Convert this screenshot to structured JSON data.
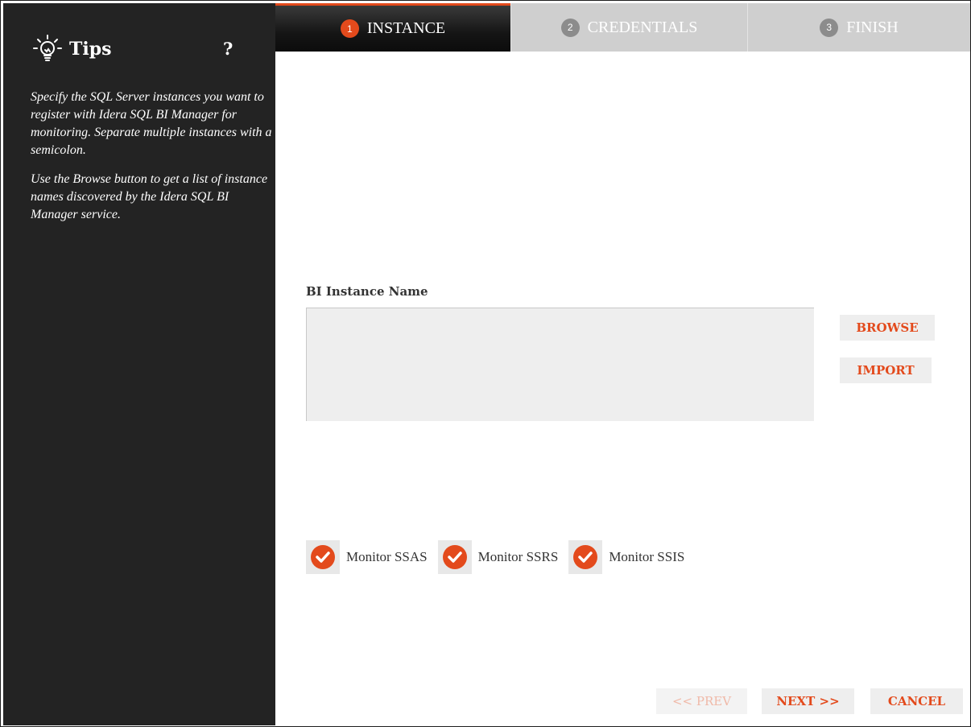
{
  "sidebar": {
    "title": "Tips",
    "help": "?",
    "tips": [
      "Specify the SQL Server instances you want to register with Idera SQL BI Manager for monitoring. Separate multiple instances with a semicolon.",
      "Use the Browse button to get a list of instance names discovered by the Idera SQL BI Manager service."
    ]
  },
  "tabs": [
    {
      "num": "1",
      "label": "INSTANCE"
    },
    {
      "num": "2",
      "label": "CREDENTIALS"
    },
    {
      "num": "3",
      "label": "FINISH"
    }
  ],
  "form": {
    "label": "BI Instance Name",
    "value": "",
    "browse": "BROWSE",
    "import": "IMPORT"
  },
  "checkboxes": [
    {
      "label": "Monitor SSAS",
      "checked": true
    },
    {
      "label": "Monitor SSRS",
      "checked": true
    },
    {
      "label": "Monitor SSIS",
      "checked": true
    }
  ],
  "footer": {
    "prev": "<< PREV",
    "next": "NEXT >>",
    "cancel": "CANCEL"
  },
  "colors": {
    "accent": "#e34a1c",
    "sidebar_bg": "#232323",
    "tab_inactive": "#cfcfcf"
  }
}
